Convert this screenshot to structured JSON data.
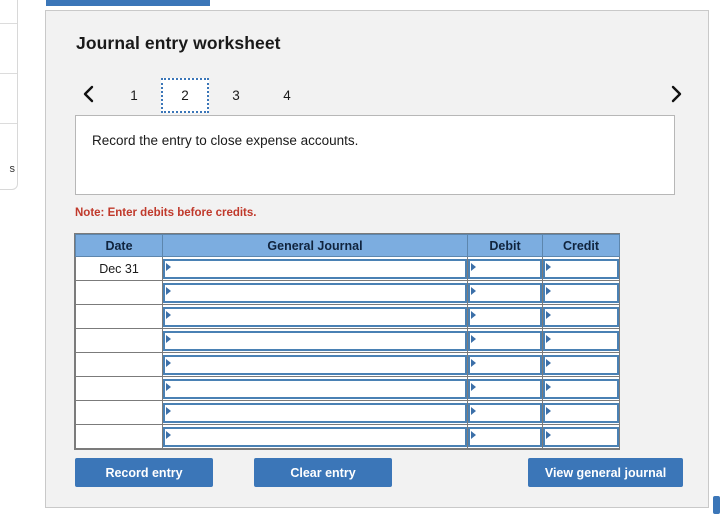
{
  "panel": {
    "title": "Journal entry worksheet",
    "instruction": "Record the entry to close expense accounts.",
    "note": "Note: Enter debits before credits."
  },
  "pager": {
    "prev_icon": "chevron-left-icon",
    "next_icon": "chevron-right-icon",
    "pages": [
      {
        "label": "1",
        "active": false
      },
      {
        "label": "2",
        "active": true
      },
      {
        "label": "3",
        "active": false
      },
      {
        "label": "4",
        "active": false
      }
    ],
    "active_page": "2"
  },
  "table": {
    "headers": {
      "date": "Date",
      "general_journal": "General Journal",
      "debit": "Debit",
      "credit": "Credit"
    },
    "rows": [
      {
        "date": "Dec 31",
        "general_journal": "",
        "debit": "",
        "credit": ""
      },
      {
        "date": "",
        "general_journal": "",
        "debit": "",
        "credit": ""
      },
      {
        "date": "",
        "general_journal": "",
        "debit": "",
        "credit": ""
      },
      {
        "date": "",
        "general_journal": "",
        "debit": "",
        "credit": ""
      },
      {
        "date": "",
        "general_journal": "",
        "debit": "",
        "credit": ""
      },
      {
        "date": "",
        "general_journal": "",
        "debit": "",
        "credit": ""
      },
      {
        "date": "",
        "general_journal": "",
        "debit": "",
        "credit": ""
      },
      {
        "date": "",
        "general_journal": "",
        "debit": "",
        "credit": ""
      }
    ]
  },
  "buttons": {
    "record_entry": "Record entry",
    "clear_entry": "Clear entry",
    "view_general_journal": "View general journal"
  },
  "sidebar_fragment": {
    "text": "s"
  },
  "colors": {
    "accent_blue": "#3b76b8",
    "header_blue": "#7cade0",
    "select_border": "#4a81b4",
    "note_red": "#c0392b",
    "panel_bg": "#f2f2f2"
  }
}
